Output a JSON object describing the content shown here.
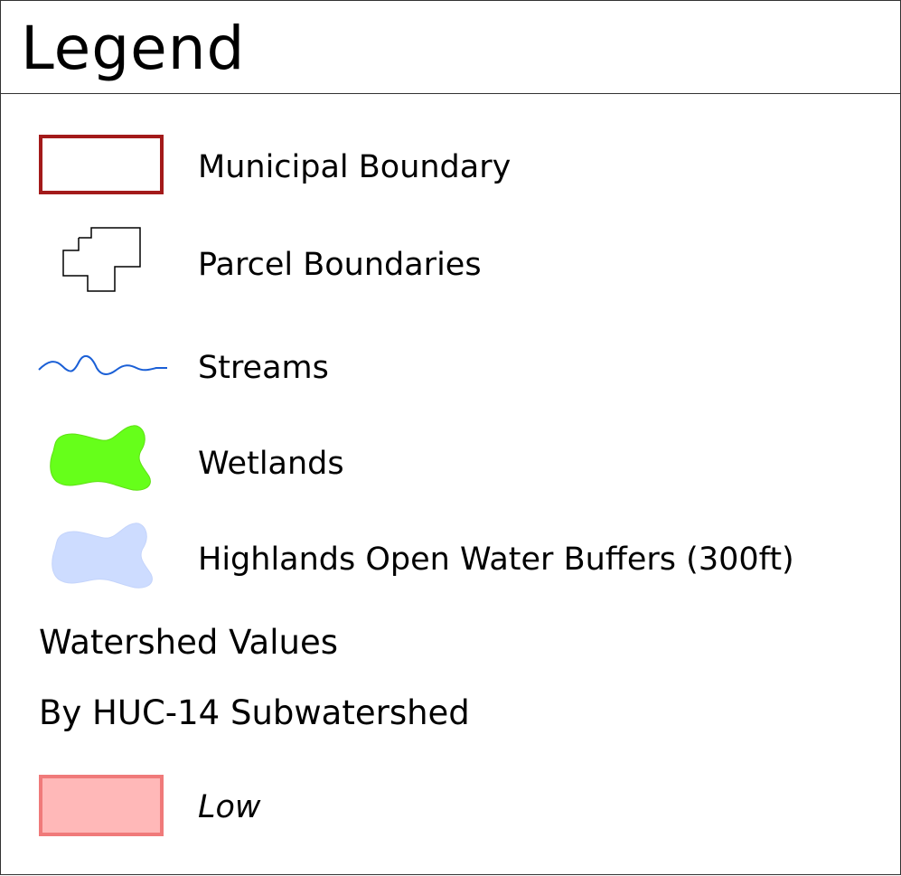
{
  "legend": {
    "title": "Legend",
    "items": [
      {
        "label": "Municipal Boundary",
        "icon": "municipal-boundary-icon",
        "stroke": "#a31a1a",
        "fill": "#ffffff"
      },
      {
        "label": "Parcel Boundaries",
        "icon": "parcel-boundary-icon",
        "stroke": "#000000"
      },
      {
        "label": "Streams",
        "icon": "stream-line-icon",
        "stroke": "#1a5fd6"
      },
      {
        "label": "Wetlands",
        "icon": "wetland-patch-icon",
        "fill": "#66ff1a"
      },
      {
        "label": "Highlands Open Water Buffers (300ft)",
        "icon": "water-buffer-patch-icon",
        "fill": "#cddcff"
      }
    ],
    "section": {
      "line1": "Watershed Values",
      "line2": "By HUC-14 Subwatershed",
      "classes": [
        {
          "label": "Low",
          "icon": "low-value-swatch-icon",
          "fill": "#ffb8b8",
          "stroke": "#f07a7a"
        }
      ]
    }
  }
}
